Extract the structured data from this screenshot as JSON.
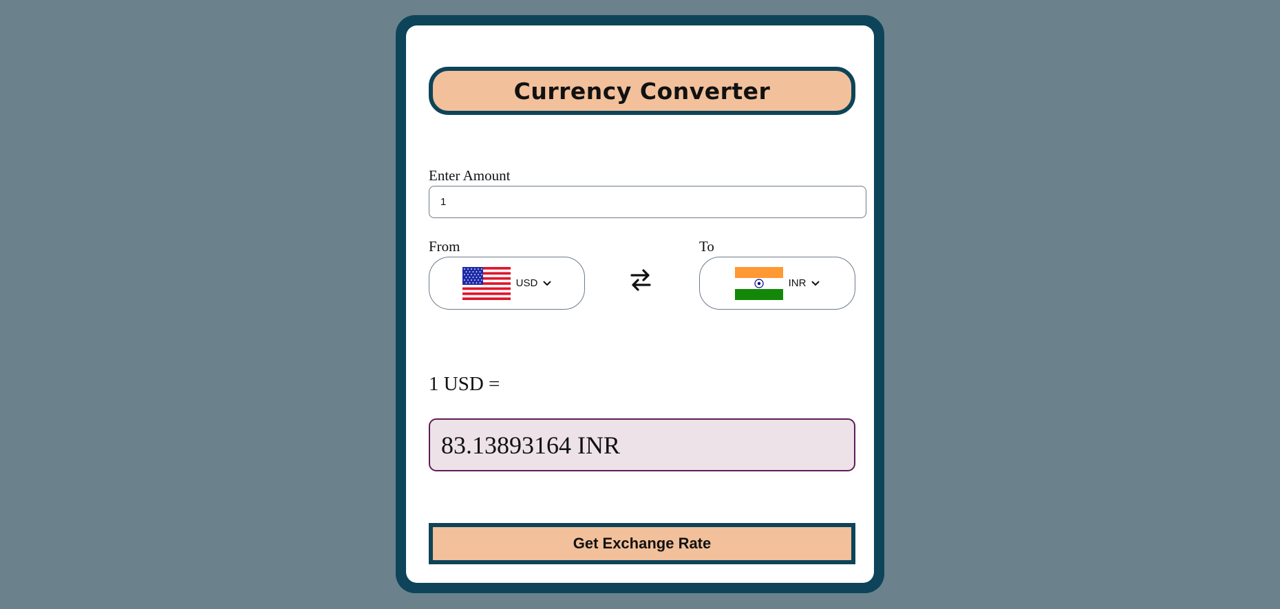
{
  "app": {
    "title": "Currency Converter"
  },
  "amount": {
    "label": "Enter Amount",
    "value": "1"
  },
  "from": {
    "label": "From",
    "currency": "USD",
    "flag_icon": "us-flag-icon"
  },
  "to": {
    "label": "To",
    "currency": "INR",
    "flag_icon": "india-flag-icon"
  },
  "swap": {
    "icon": "swap-arrows-icon"
  },
  "result": {
    "prefix": "1 USD =",
    "value": "83.13893164 INR"
  },
  "actions": {
    "get_rate_label": "Get Exchange Rate"
  },
  "colors": {
    "background": "#6b818c",
    "frame": "#0d4459",
    "accent": "#f2c09a",
    "result_bg": "#ede2e7",
    "result_border": "#5c1d57"
  }
}
